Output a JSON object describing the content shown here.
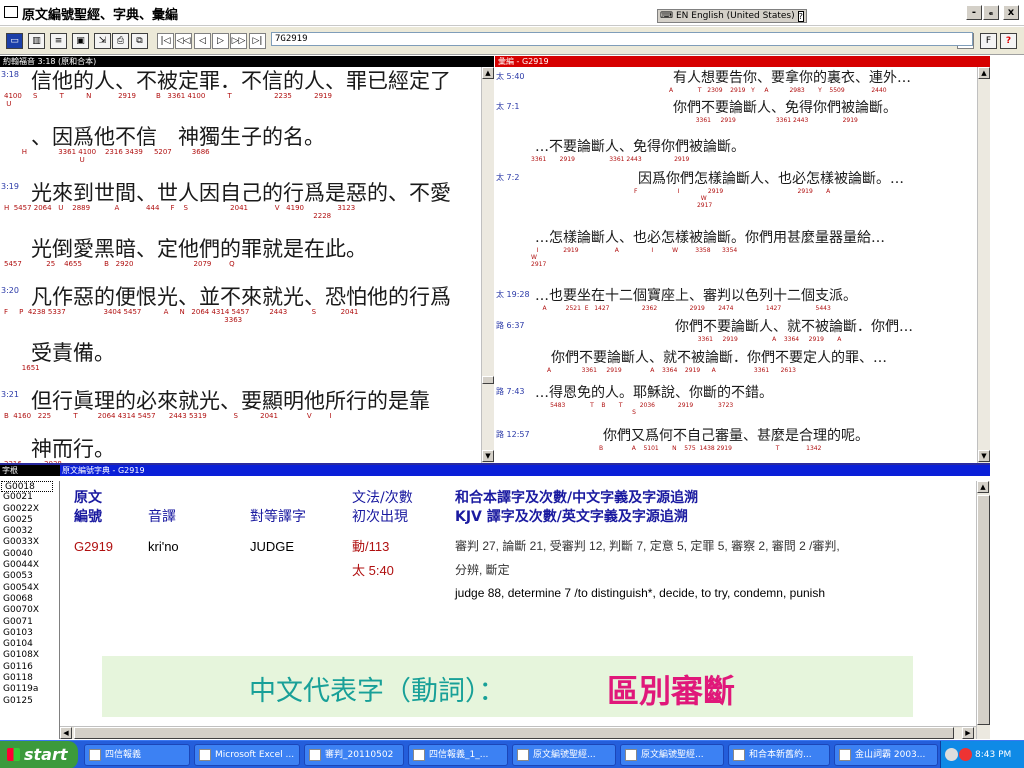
{
  "window": {
    "title": "原文編號聖經、字典、彙編",
    "language": "EN English (United States)",
    "minimize": "-",
    "restore": "ₑ",
    "close": "x"
  },
  "toolbar": {
    "reference": "7G2919",
    "nav_first": "|◁",
    "nav_prev_page": "◁◁",
    "nav_prev": "◁",
    "nav_next": "▷",
    "nav_next_page": "▷▷",
    "nav_last": "▷|",
    "dropdown_arrow": "▾",
    "help": "?"
  },
  "verse_pane": {
    "header": "約翰福音 3:18 (原和合本)",
    "verses": [
      {
        "no": "3:18",
        "lines": [
          {
            "text": "信他的人、不被定罪．不信的人、罪已經定了",
            "nums": "4100     S          T          N            2919         B   3361 4100          T                   2235          2919\n U"
          },
          {
            "text": "、因爲他不信　神獨生子的名。",
            "nums": "        H              3361 4100    2316 3439     5207         3686\n                                  U"
          }
        ]
      },
      {
        "no": "3:19",
        "lines": [
          {
            "text": "光來到世間、世人因自己的行爲是惡的、不愛",
            "nums": "H  5457 2064   U    2889           A            444     F    S                   2041            V   4190               3123\n                                                                                                                                           2228"
          },
          {
            "text": "光倒愛黑暗、定他們的罪就是在此。",
            "nums": "5457           25    4655          B   2920                           2079        Q"
          }
        ]
      },
      {
        "no": "3:20",
        "lines": [
          {
            "text": "凡作惡的便恨光、並不來就光、恐怕他的行爲",
            "nums": "F     P  4238 5337                 3404 5457          A     N   2064 4314 5457         2443           S           2041\n                                                                                                   3363"
          },
          {
            "text": "受責備。",
            "nums": "        1651"
          }
        ]
      },
      {
        "no": "3:21",
        "lines": [
          {
            "text": "但行眞理的必來就光、要顯明他所行的是靠",
            "nums": "B  4160   225          T         2064 4314 5457      2443 5319            S          2041             V        I"
          },
          {
            "text": "神而行。",
            "nums": "2316          2038"
          }
        ]
      }
    ]
  },
  "concordance_pane": {
    "header": "彙編 - G2919",
    "rows": [
      {
        "ref": "太 5:40",
        "text": "有人想要告你、要拿你的裏衣、連外…",
        "nums": "A             T   2309    2919   Y     A           2983       Y    5509              2440"
      },
      {
        "ref": "太 7:1",
        "text": "你們不要論斷人、免得你們被論斷。",
        "nums": "              3361     2919                     3361 2443                  2919"
      },
      {
        "ref": "",
        "text": "…不要論斷人、免得你們被論斷。",
        "nums": "3361       2919                  3361 2443                 2919"
      },
      {
        "ref": "太 7:2",
        "text": "因爲你們怎樣論斷人、也必怎樣被論斷。…",
        "nums": "F                     I               2919                                       2919       A\n                                   W\n                                 2917"
      },
      {
        "ref": "",
        "text": "…怎樣論斷人、也必怎樣被論斷。你們用甚麼量器量給…",
        "nums": "   I             2919                   A                 I          W         3358      3354\nW\n2917"
      },
      {
        "ref": "太 19:28",
        "text": "…也要坐在十二個寶座上、審判以色列十二個支派。",
        "nums": "      A          2521  E   1427                 2362                 2919       2474                 1427                  5443"
      },
      {
        "ref": "路 6:37",
        "text": "你們不要論斷人、就不被論斷．你們…",
        "nums": "              3361     2919                  A    3364     2919       A"
      },
      {
        "ref": "",
        "text": "你們不要論斷人、就不被論斷．你們不要定人的罪、…",
        "nums": "A                3361     2919               A    3364    2919      A                    3361      2613"
      },
      {
        "ref": "路 7:43",
        "text": "…得恩免的人。耶穌說、你斷的不錯。",
        "nums": "          5483             T    B       T         2036            2919             3723\n                                                     S"
      },
      {
        "ref": "路 12:57",
        "text": "你們又爲何不自己審量、甚麼是合理的呢。",
        "nums": "B               A    5101       N    575  1438 2919                       T              1342"
      }
    ]
  },
  "lexicon": {
    "list_header": "字根",
    "header": "原文編號字典 - G2919",
    "codes": [
      "G0018",
      "G0021",
      "G0022X",
      "G0025",
      "G0032",
      "G0033X",
      "G0040",
      "G0044X",
      "G0053",
      "G0054X",
      "G0068",
      "G0070X",
      "G0071",
      "G0103",
      "G0104",
      "G0108X",
      "G0116",
      "G0118",
      "G0119a",
      "G0125"
    ],
    "columns": {
      "number_1": "原文",
      "number_2": "編號",
      "pronunciation": "音譯",
      "equivalent": "對等譯字",
      "grammar_1": "文法/次數",
      "grammar_2": "初次出現",
      "cunp": "和合本譯字及次數/中文字義及字源追溯",
      "kjv": "KJV 譯字及次數/英文字義及字源追溯"
    },
    "entry": {
      "number": "G2919",
      "pronunciation": "kri'no",
      "equivalent": "JUDGE",
      "grammar": "動/113",
      "first_occurrence": "太 5:40",
      "cunp_line1": "審判 27, 論斷 21, 受審判 12, 判斷 7, 定意 5, 定罪 5, 審察 2, 審問 2 /審判,",
      "cunp_line2": "分辨, 斷定",
      "kjv": "judge 88, determine 7 /to distinguish*, decide, to try, condemn, punish"
    },
    "banner_label": "中文代表字（動詞）：",
    "banner_value": "區別審斷"
  },
  "taskbar": {
    "start": "start",
    "tasks": [
      "四信報義",
      "Microsoft Excel ...",
      "審判_20110502",
      "四信報義_1_...",
      "原文編號聖經...",
      "原文編號聖經...",
      "和合本新舊約...",
      "金山詞霸 2003..."
    ],
    "clock": "8:43 PM"
  }
}
